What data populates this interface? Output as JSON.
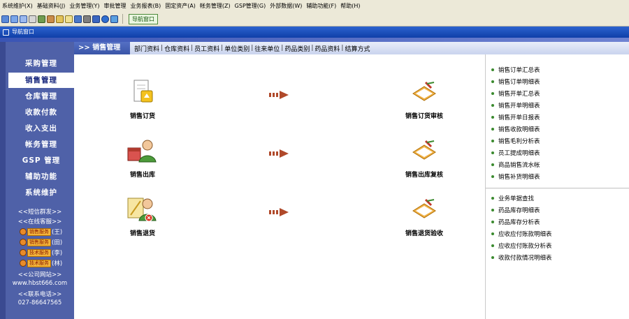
{
  "menu": [
    "系统维护(X)",
    "基础资料(J)",
    "业务管理(Y)",
    "审批管理",
    "业务报表(B)",
    "固定资产(A)",
    "帐务管理(Z)",
    "GSP管理(G)",
    "外部数据(W)",
    "辅助功能(F)",
    "帮助(H)"
  ],
  "toolbar": {
    "icons": [
      "exit-icon",
      "calculator-icon",
      "window-icon",
      "calendar-icon",
      "grid-icon",
      "user-icon",
      "lock-icon",
      "notes-icon",
      "mail-icon",
      "print-icon",
      "save-icon",
      "help-icon",
      "refresh-icon"
    ],
    "nav_window_label": "导航窗口"
  },
  "window_title": "导航窗口",
  "sidebar": {
    "items": [
      {
        "label": "采购管理",
        "active": false
      },
      {
        "label": "销售管理",
        "active": true
      },
      {
        "label": "仓库管理",
        "active": false
      },
      {
        "label": "收款付款",
        "active": false
      },
      {
        "label": "收入支出",
        "active": false
      },
      {
        "label": "帐务管理",
        "active": false
      },
      {
        "label": "GSP 管理",
        "active": false
      },
      {
        "label": "辅助功能",
        "active": false
      },
      {
        "label": "系统维护",
        "active": false
      }
    ],
    "sms": "<<短信群发>>",
    "online_service": "<<在线客服>>",
    "online_contacts": [
      {
        "label": "销售服务",
        "name": "(王)"
      },
      {
        "label": "销售服务",
        "name": "(田)"
      },
      {
        "label": "技术服务",
        "name": "(李)"
      },
      {
        "label": "技术服务",
        "name": "(林)"
      }
    ],
    "website_title": "<<公司网站>>",
    "website": "www.hbst666.com",
    "phone_title": "<<联系电话>>",
    "phone": "027-86647565"
  },
  "tabs": {
    "module": ">> 销售管理",
    "links": [
      "部门资料",
      "仓库资料",
      "员工资料",
      "单位类别",
      "往来单位",
      "药品类别",
      "药品资料",
      "结算方式"
    ]
  },
  "flow": {
    "nodes": [
      {
        "label": "销售订货",
        "icon": "order-icon"
      },
      {
        "label": "销售订货审核",
        "icon": "review-icon"
      },
      {
        "label": "销售出库",
        "icon": "delivery-icon"
      },
      {
        "label": "销售出库复核",
        "icon": "recheck-icon"
      },
      {
        "label": "销售退货",
        "icon": "return-icon"
      },
      {
        "label": "销售退货验收",
        "icon": "inspect-icon"
      }
    ]
  },
  "reports": {
    "group1": [
      "销售订单汇总表",
      "销售订单明细表",
      "销售开单汇总表",
      "销售开单明细表",
      "销售开单日报表",
      "销售收款明细表",
      "销售毛利分析表",
      "员工提成明细表",
      "商品销售流水帐",
      "销售补货明细表"
    ],
    "group2": [
      "业务单据查找",
      "药品库存明细表",
      "药品库存分析表",
      "应收应付账款明细表",
      "应收应付账款分析表",
      "收款付款情况明细表"
    ]
  },
  "colors": {
    "sidebar_bg": "#4f61a8",
    "title_bar": "#1c4fbf",
    "accent_arrow": "#b0492a",
    "bullet": "#3b8a2f"
  }
}
